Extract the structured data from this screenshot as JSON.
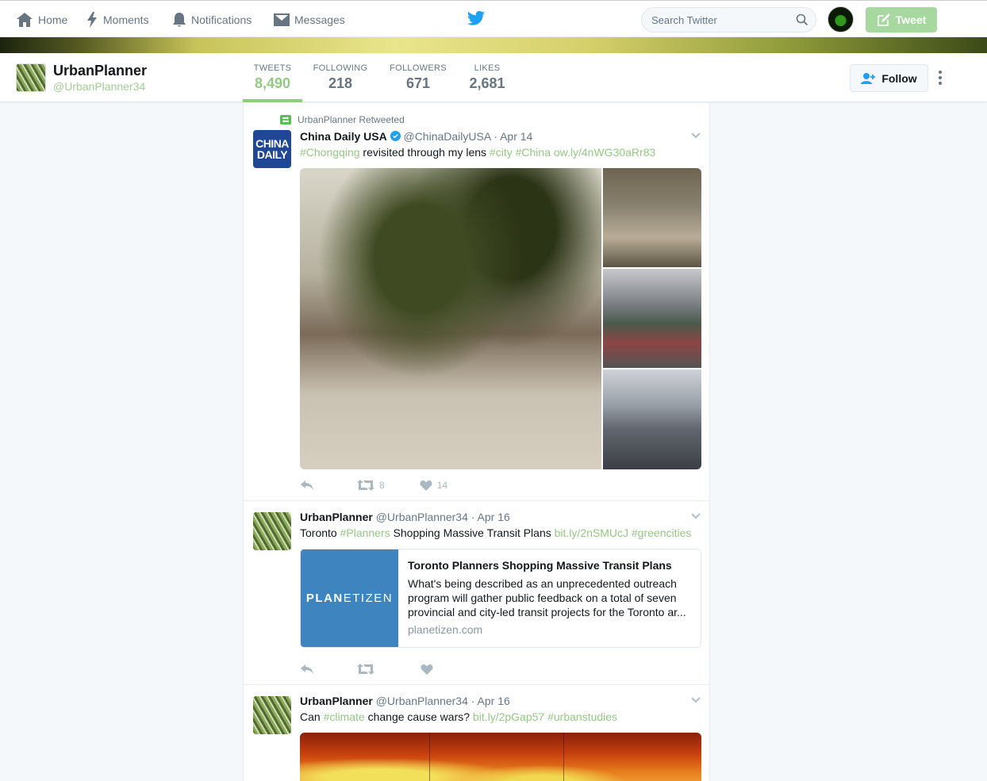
{
  "nav": {
    "home": "Home",
    "moments": "Moments",
    "notifications": "Notifications",
    "messages": "Messages",
    "search_placeholder": "Search Twitter",
    "tweet_button": "Tweet"
  },
  "profile": {
    "name": "UrbanPlanner",
    "handle": "@UrbanPlanner34",
    "stats": [
      {
        "label": "TWEETS",
        "value": "8,490"
      },
      {
        "label": "FOLLOWING",
        "value": "218"
      },
      {
        "label": "FOLLOWERS",
        "value": "671"
      },
      {
        "label": "LIKES",
        "value": "2,681"
      }
    ],
    "follow_label": "Follow"
  },
  "tweets": [
    {
      "context": "UrbanPlanner Retweeted",
      "avatar_text_1": "CHINA",
      "avatar_text_2": "DAILY",
      "name": "China Daily USA",
      "handle": "@ChinaDailyUSA",
      "date": "· Apr 14",
      "text_parts": [
        "#Chongqing",
        " revisited through my lens ",
        "#city",
        " ",
        "#China",
        " ",
        "ow.ly/4nWG30aRr83"
      ],
      "retweets": "8",
      "likes": "14"
    },
    {
      "name": "UrbanPlanner",
      "handle": "@UrbanPlanner34",
      "date": "· Apr 16",
      "text_parts": [
        "Toronto ",
        "#Planners",
        " Shopping Massive Transit Plans ",
        "bit.ly/2nSMUcJ",
        " ",
        "#greencities"
      ],
      "card": {
        "image_text_bold": "PLAN",
        "image_text_rest": "ETIZEN",
        "title": "Toronto Planners Shopping Massive Transit Plans",
        "description": "What's being described as an unprecedented outreach program will gather public feedback on a total of seven provincial and city-led transit projects for the Toronto ar...",
        "domain": "planetizen.com"
      }
    },
    {
      "name": "UrbanPlanner",
      "handle": "@UrbanPlanner34",
      "date": "· Apr 16",
      "text_parts": [
        "Can ",
        "#climate",
        " change cause wars? ",
        "bit.ly/2pGap57",
        " ",
        "#urbanstudies"
      ]
    }
  ],
  "colors": {
    "accent_green": "#94c884",
    "tweet_button_bg": "#a7d8a0",
    "verified_blue": "#1da1f2",
    "twitter_bird": "#1da1f2"
  }
}
